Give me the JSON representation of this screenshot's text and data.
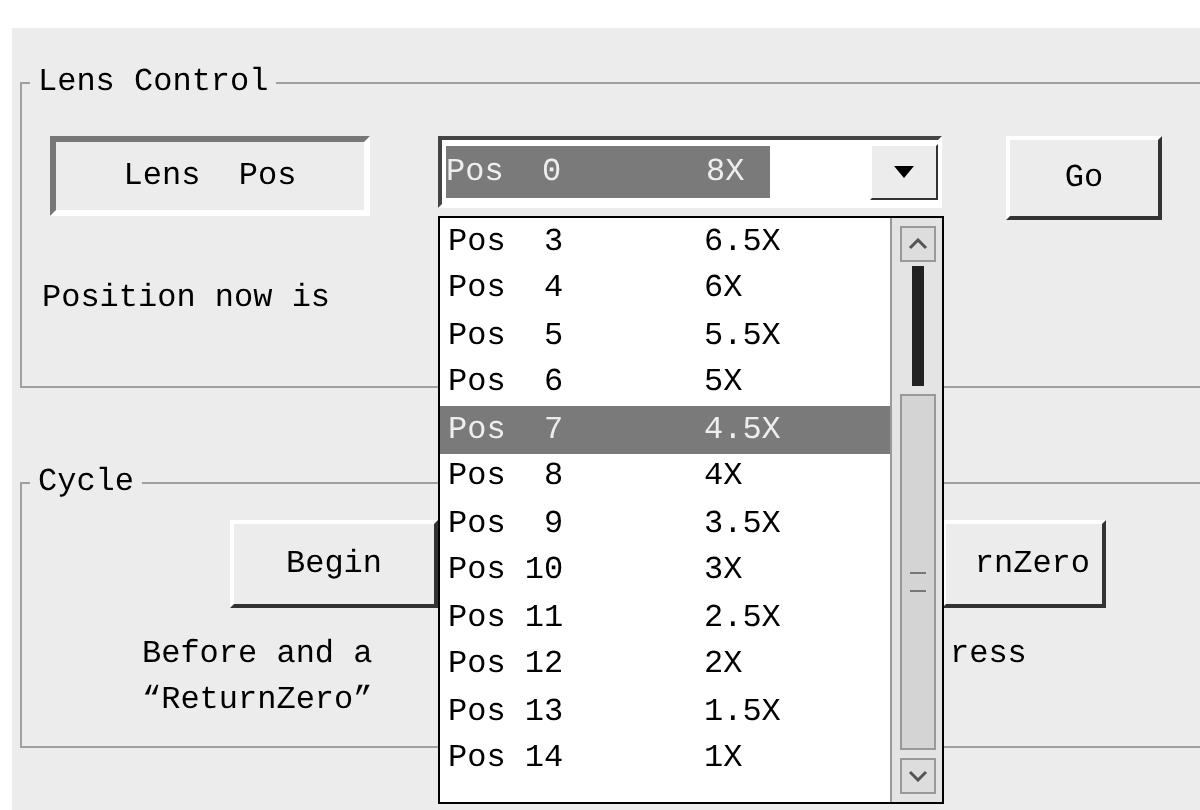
{
  "lens_control": {
    "title": "Lens Control",
    "lens_pos_label": "Lens  Pos",
    "position_text": "Position now is",
    "combo": {
      "label": "Pos  0",
      "zoom": "8X",
      "focused": true
    },
    "go_button": "Go"
  },
  "cycle": {
    "title": "Cycle",
    "begin_button": "Begin",
    "return_zero_button": "rnZero",
    "note_left": [
      "Before and a",
      "“ReturnZero”"
    ],
    "note_right": "ress"
  },
  "dropdown": {
    "items": [
      {
        "label": "Pos  3",
        "zoom": "6.5X",
        "selected": false
      },
      {
        "label": "Pos  4",
        "zoom": "6X",
        "selected": false
      },
      {
        "label": "Pos  5",
        "zoom": "5.5X",
        "selected": false
      },
      {
        "label": "Pos  6",
        "zoom": "5X",
        "selected": false
      },
      {
        "label": "Pos  7",
        "zoom": "4.5X",
        "selected": true
      },
      {
        "label": "Pos  8",
        "zoom": "4X",
        "selected": false
      },
      {
        "label": "Pos  9",
        "zoom": "3.5X",
        "selected": false
      },
      {
        "label": "Pos 10",
        "zoom": "3X",
        "selected": false
      },
      {
        "label": "Pos 11",
        "zoom": "2.5X",
        "selected": false
      },
      {
        "label": "Pos 12",
        "zoom": "2X",
        "selected": false
      },
      {
        "label": "Pos 13",
        "zoom": "1.5X",
        "selected": false
      },
      {
        "label": "Pos 14",
        "zoom": "1X",
        "selected": false
      }
    ]
  }
}
